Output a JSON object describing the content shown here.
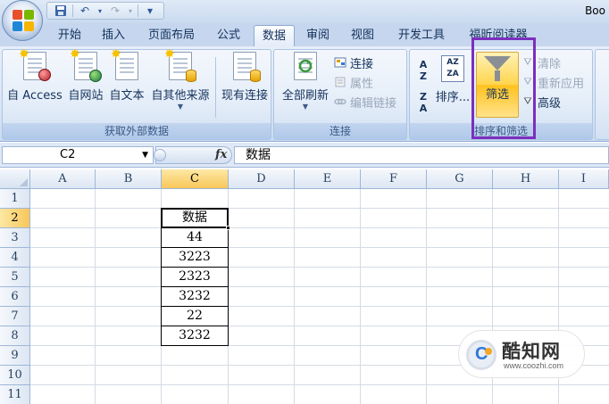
{
  "window": {
    "title_fragment": "Boo"
  },
  "quick_access": {
    "save_icon": "save-icon",
    "undo_icon": "undo-icon",
    "redo_icon": "redo-icon",
    "customize_icon": "customize-icon",
    "undo_glyph": "↶",
    "redo_glyph": "↷",
    "customize_glyph": "▾"
  },
  "tabs": [
    {
      "label": "开始"
    },
    {
      "label": "插入"
    },
    {
      "label": "页面布局"
    },
    {
      "label": "公式"
    },
    {
      "label": "数据",
      "active": true
    },
    {
      "label": "审阅"
    },
    {
      "label": "视图"
    },
    {
      "label": "开发工具"
    },
    {
      "label": "福昕阅读器"
    }
  ],
  "ribbon": {
    "external_data": {
      "group_label": "获取外部数据",
      "buttons": [
        {
          "label": "自 Access"
        },
        {
          "label": "自网站"
        },
        {
          "label": "自文本"
        },
        {
          "label": "自其他来源"
        }
      ],
      "existing": {
        "label": "现有连接"
      }
    },
    "connections": {
      "group_label": "连接",
      "refresh_all": {
        "label": "全部刷新"
      },
      "connect": {
        "label": "连接"
      },
      "properties": {
        "label": "属性"
      },
      "edit_links": {
        "label": "编辑链接"
      }
    },
    "sort_filter": {
      "group_label": "排序和筛选",
      "sort_asc_top": "A",
      "sort_asc_bottom": "Z",
      "sort_desc_top": "Z",
      "sort_desc_bottom": "A",
      "sort_box": "AZ ZA",
      "sort": {
        "label": "排序..."
      },
      "filter": {
        "label": "筛选"
      },
      "clear": {
        "label": "清除"
      },
      "reapply": {
        "label": "重新应用"
      },
      "advanced": {
        "label": "高级"
      },
      "highlight_color": "#7b2fbe"
    }
  },
  "formula_bar": {
    "name_box": "C2",
    "fx_label": "fx",
    "content": "数据"
  },
  "sheet": {
    "columns": [
      "A",
      "B",
      "C",
      "D",
      "E",
      "F",
      "G",
      "H",
      "I"
    ],
    "rows": [
      "1",
      "2",
      "3",
      "4",
      "5",
      "6",
      "7",
      "8",
      "9",
      "10",
      "11"
    ],
    "selected_column": "C",
    "selected_row": "2",
    "column_c_values": [
      "数据",
      "44",
      "3223",
      "2323",
      "3232",
      "22",
      "3232"
    ]
  },
  "watermark": {
    "title": "酷知网",
    "url": "www.coozhi.com"
  }
}
